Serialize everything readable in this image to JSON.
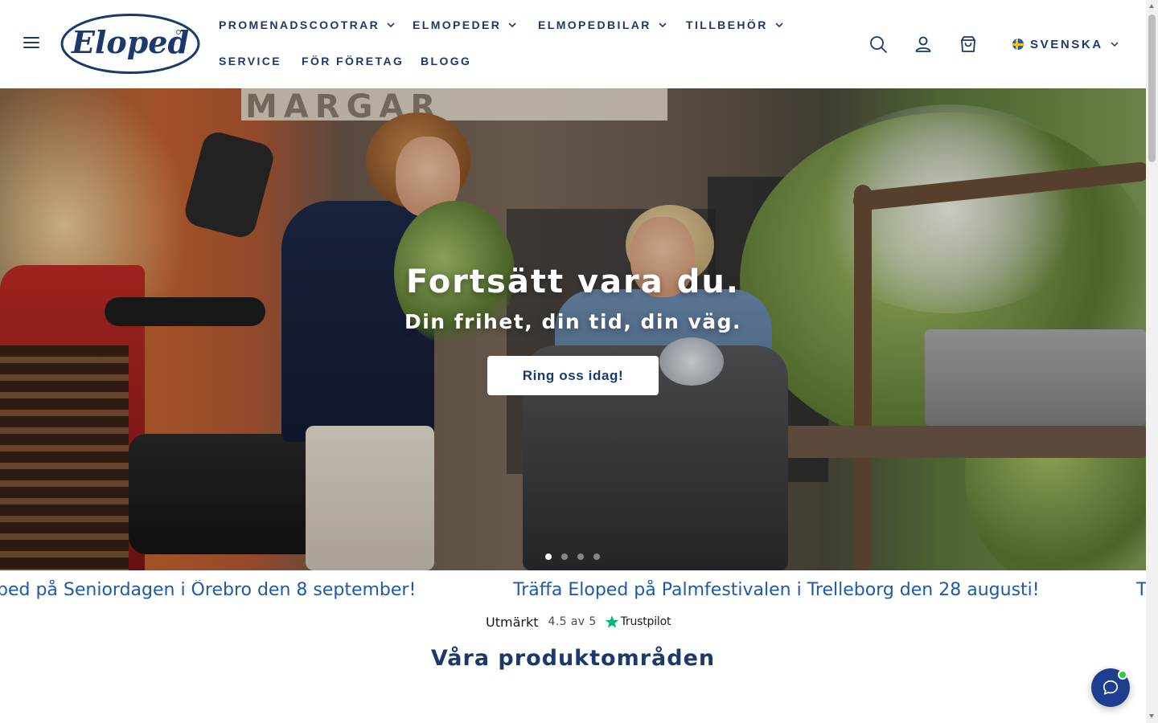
{
  "header": {
    "logo_text": "Eloped",
    "nav": [
      {
        "label": "PROMENADSCOOTRAR",
        "has_dropdown": true
      },
      {
        "label": "ELMOPEDER",
        "has_dropdown": true
      },
      {
        "label": "ELMOPEDBILAR",
        "has_dropdown": true
      },
      {
        "label": "TILLBEHÖR",
        "has_dropdown": true
      },
      {
        "label": "SERVICE",
        "has_dropdown": false
      },
      {
        "label": "FÖR FÖRETAG",
        "has_dropdown": false
      },
      {
        "label": "BLOGG",
        "has_dropdown": false
      }
    ],
    "icons": [
      "menu-icon",
      "search-icon",
      "account-icon",
      "cart-icon"
    ],
    "language": {
      "label": "SVENSKA",
      "flag": "sweden-flag-icon"
    }
  },
  "hero": {
    "title": "Fortsätt vara du.",
    "subtitle": "Din frihet, din tid, din väg.",
    "cta_label": "Ring oss idag!",
    "slides_count": 4,
    "active_slide": 1,
    "facade_text": "MARGAR"
  },
  "announcements": [
    "ped på Seniordagen i Örebro den 8 september!",
    "Träffa Eloped på Palmfestivalen i Trelleborg den 28 augusti!",
    "T"
  ],
  "trustpilot": {
    "rating_label": "Utmärkt",
    "score": "4.5 av 5",
    "brand": "Trustpilot",
    "star_color": "#00b67a"
  },
  "section": {
    "title": "Våra produktområden"
  },
  "colors": {
    "brand_navy": "#1b3a6b",
    "marquee_blue": "#1e5aa8",
    "chat_bg": "#1e3f8f",
    "online_green": "#2ecc40"
  }
}
